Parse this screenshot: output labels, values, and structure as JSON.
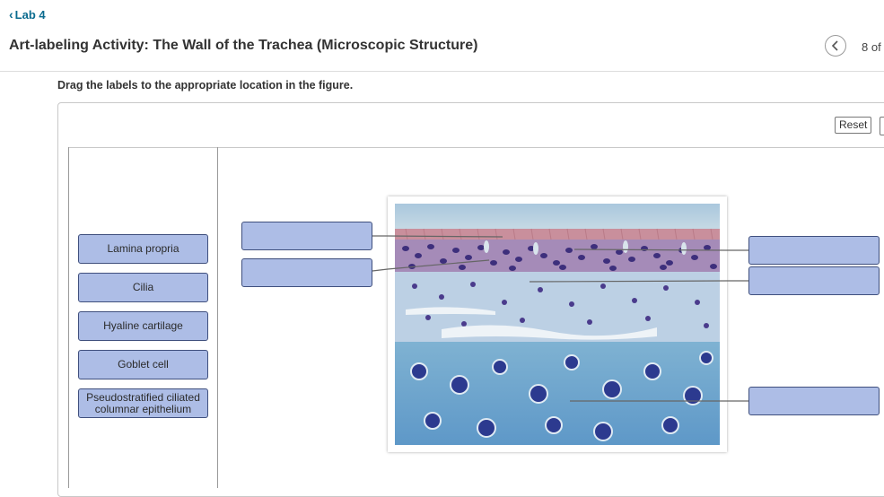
{
  "header": {
    "back_label": "Lab 4",
    "title": "Art-labeling Activity: The Wall of the Trachea (Microscopic Structure)",
    "page_count": "8 of"
  },
  "activity": {
    "instructions": "Drag the labels to the appropriate location in the figure.",
    "reset_label": "Reset"
  },
  "label_bank": [
    "Lamina propria",
    "Cilia",
    "Hyaline cartilage",
    "Goblet cell",
    "Pseudostratified ciliated columnar epithelium"
  ],
  "figure": {
    "subject": "trachea wall micrograph"
  }
}
